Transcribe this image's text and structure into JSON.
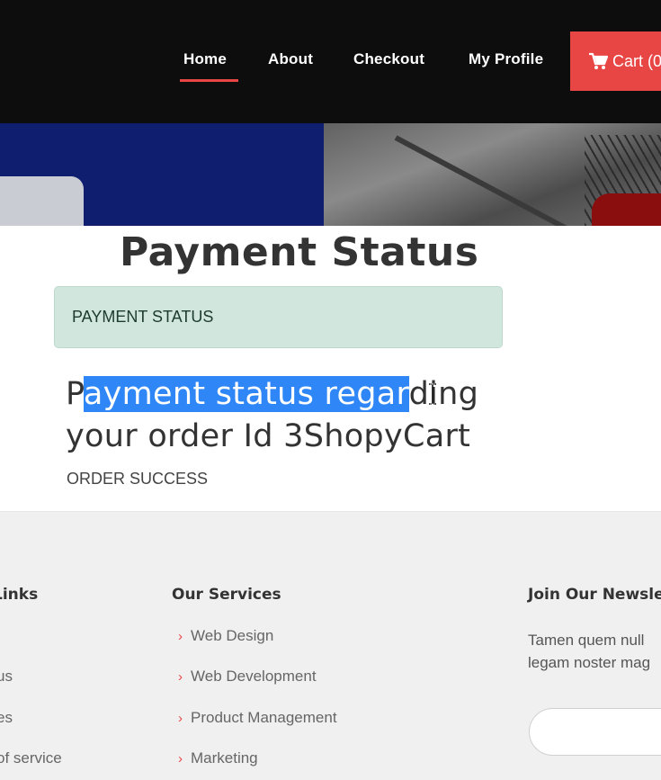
{
  "nav": {
    "home": "Home",
    "about": "About",
    "checkout": "Checkout",
    "profile": "My Profile",
    "cart": "Cart (0"
  },
  "main": {
    "title": "Payment Status",
    "alert": "PAYMENT STATUS",
    "message_line1_pre": "P",
    "message_line1_highlight": "ayment status regar",
    "message_line1_post": "ding",
    "message_line2": "your order Id 3ShopyCart",
    "order_status": "ORDER SUCCESS"
  },
  "footer": {
    "links_heading": "Links",
    "links": [
      "us",
      "es",
      "of service"
    ],
    "services_heading": "Our Services",
    "services": [
      "Web Design",
      "Web Development",
      "Product Management",
      "Marketing"
    ],
    "newsletter_heading": "Join Our Newsle",
    "newsletter_line1": "Tamen quem null",
    "newsletter_line2": "legam noster mag"
  },
  "colors": {
    "accent": "#e84545",
    "alert_bg": "#d1e7dd",
    "selection": "#2f86f6",
    "nav_bg": "#0d0d0d"
  },
  "icons": {
    "cart": "shopping-cart-icon",
    "chevron": "chevron-right-icon",
    "cursor": "text-cursor-icon"
  }
}
